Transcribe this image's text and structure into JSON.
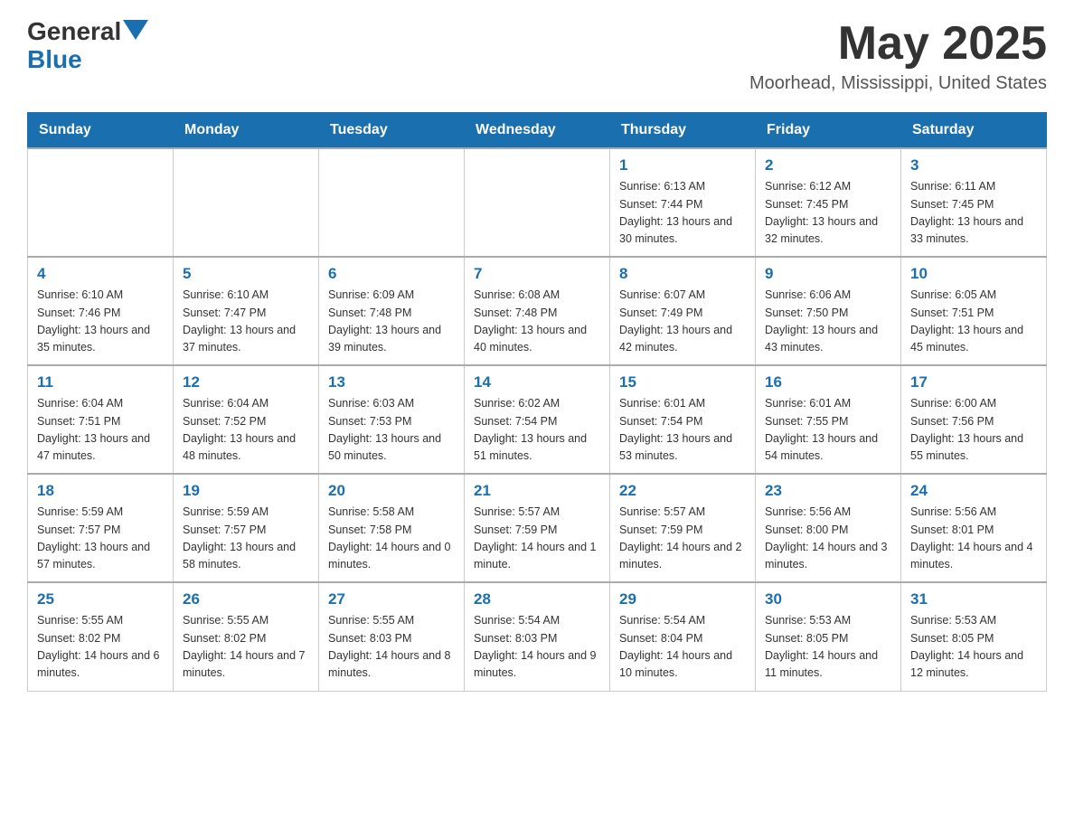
{
  "header": {
    "logo_general": "General",
    "logo_blue": "Blue",
    "month_year": "May 2025",
    "location": "Moorhead, Mississippi, United States"
  },
  "calendar": {
    "days_of_week": [
      "Sunday",
      "Monday",
      "Tuesday",
      "Wednesday",
      "Thursday",
      "Friday",
      "Saturday"
    ],
    "weeks": [
      [
        {
          "day": "",
          "info": ""
        },
        {
          "day": "",
          "info": ""
        },
        {
          "day": "",
          "info": ""
        },
        {
          "day": "",
          "info": ""
        },
        {
          "day": "1",
          "info": "Sunrise: 6:13 AM\nSunset: 7:44 PM\nDaylight: 13 hours and 30 minutes."
        },
        {
          "day": "2",
          "info": "Sunrise: 6:12 AM\nSunset: 7:45 PM\nDaylight: 13 hours and 32 minutes."
        },
        {
          "day": "3",
          "info": "Sunrise: 6:11 AM\nSunset: 7:45 PM\nDaylight: 13 hours and 33 minutes."
        }
      ],
      [
        {
          "day": "4",
          "info": "Sunrise: 6:10 AM\nSunset: 7:46 PM\nDaylight: 13 hours and 35 minutes."
        },
        {
          "day": "5",
          "info": "Sunrise: 6:10 AM\nSunset: 7:47 PM\nDaylight: 13 hours and 37 minutes."
        },
        {
          "day": "6",
          "info": "Sunrise: 6:09 AM\nSunset: 7:48 PM\nDaylight: 13 hours and 39 minutes."
        },
        {
          "day": "7",
          "info": "Sunrise: 6:08 AM\nSunset: 7:48 PM\nDaylight: 13 hours and 40 minutes."
        },
        {
          "day": "8",
          "info": "Sunrise: 6:07 AM\nSunset: 7:49 PM\nDaylight: 13 hours and 42 minutes."
        },
        {
          "day": "9",
          "info": "Sunrise: 6:06 AM\nSunset: 7:50 PM\nDaylight: 13 hours and 43 minutes."
        },
        {
          "day": "10",
          "info": "Sunrise: 6:05 AM\nSunset: 7:51 PM\nDaylight: 13 hours and 45 minutes."
        }
      ],
      [
        {
          "day": "11",
          "info": "Sunrise: 6:04 AM\nSunset: 7:51 PM\nDaylight: 13 hours and 47 minutes."
        },
        {
          "day": "12",
          "info": "Sunrise: 6:04 AM\nSunset: 7:52 PM\nDaylight: 13 hours and 48 minutes."
        },
        {
          "day": "13",
          "info": "Sunrise: 6:03 AM\nSunset: 7:53 PM\nDaylight: 13 hours and 50 minutes."
        },
        {
          "day": "14",
          "info": "Sunrise: 6:02 AM\nSunset: 7:54 PM\nDaylight: 13 hours and 51 minutes."
        },
        {
          "day": "15",
          "info": "Sunrise: 6:01 AM\nSunset: 7:54 PM\nDaylight: 13 hours and 53 minutes."
        },
        {
          "day": "16",
          "info": "Sunrise: 6:01 AM\nSunset: 7:55 PM\nDaylight: 13 hours and 54 minutes."
        },
        {
          "day": "17",
          "info": "Sunrise: 6:00 AM\nSunset: 7:56 PM\nDaylight: 13 hours and 55 minutes."
        }
      ],
      [
        {
          "day": "18",
          "info": "Sunrise: 5:59 AM\nSunset: 7:57 PM\nDaylight: 13 hours and 57 minutes."
        },
        {
          "day": "19",
          "info": "Sunrise: 5:59 AM\nSunset: 7:57 PM\nDaylight: 13 hours and 58 minutes."
        },
        {
          "day": "20",
          "info": "Sunrise: 5:58 AM\nSunset: 7:58 PM\nDaylight: 14 hours and 0 minutes."
        },
        {
          "day": "21",
          "info": "Sunrise: 5:57 AM\nSunset: 7:59 PM\nDaylight: 14 hours and 1 minute."
        },
        {
          "day": "22",
          "info": "Sunrise: 5:57 AM\nSunset: 7:59 PM\nDaylight: 14 hours and 2 minutes."
        },
        {
          "day": "23",
          "info": "Sunrise: 5:56 AM\nSunset: 8:00 PM\nDaylight: 14 hours and 3 minutes."
        },
        {
          "day": "24",
          "info": "Sunrise: 5:56 AM\nSunset: 8:01 PM\nDaylight: 14 hours and 4 minutes."
        }
      ],
      [
        {
          "day": "25",
          "info": "Sunrise: 5:55 AM\nSunset: 8:02 PM\nDaylight: 14 hours and 6 minutes."
        },
        {
          "day": "26",
          "info": "Sunrise: 5:55 AM\nSunset: 8:02 PM\nDaylight: 14 hours and 7 minutes."
        },
        {
          "day": "27",
          "info": "Sunrise: 5:55 AM\nSunset: 8:03 PM\nDaylight: 14 hours and 8 minutes."
        },
        {
          "day": "28",
          "info": "Sunrise: 5:54 AM\nSunset: 8:03 PM\nDaylight: 14 hours and 9 minutes."
        },
        {
          "day": "29",
          "info": "Sunrise: 5:54 AM\nSunset: 8:04 PM\nDaylight: 14 hours and 10 minutes."
        },
        {
          "day": "30",
          "info": "Sunrise: 5:53 AM\nSunset: 8:05 PM\nDaylight: 14 hours and 11 minutes."
        },
        {
          "day": "31",
          "info": "Sunrise: 5:53 AM\nSunset: 8:05 PM\nDaylight: 14 hours and 12 minutes."
        }
      ]
    ]
  }
}
